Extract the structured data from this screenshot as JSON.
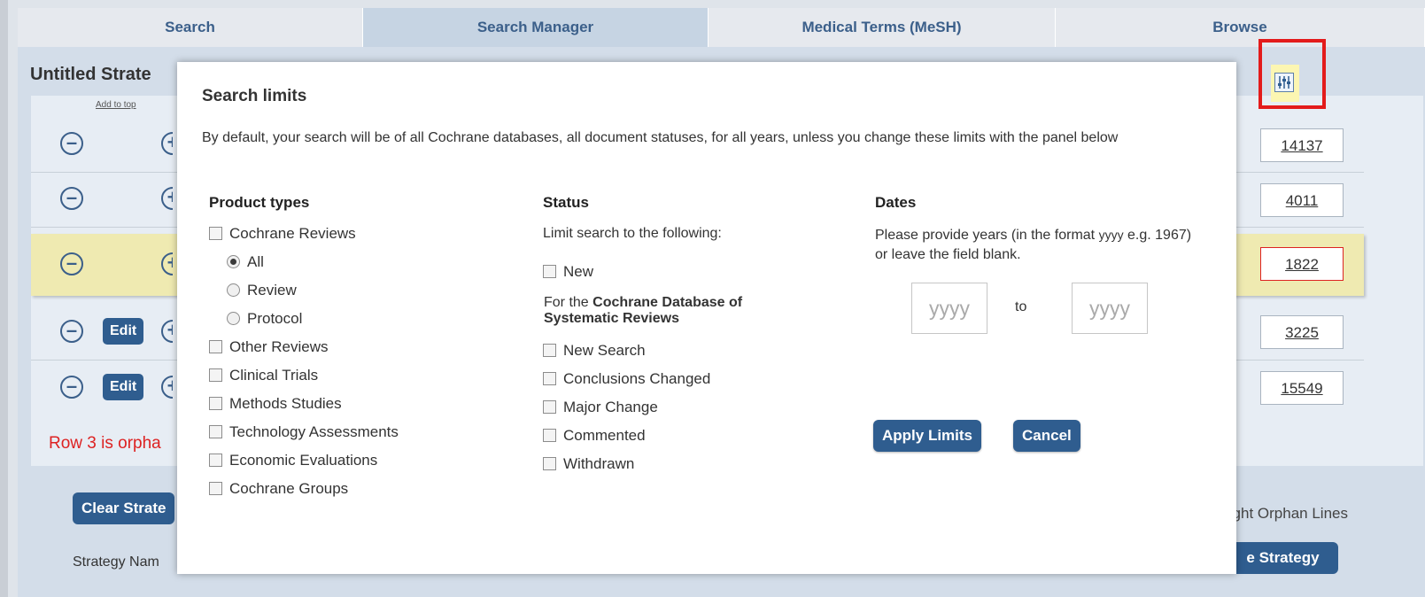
{
  "tabs": [
    {
      "label": "Search"
    },
    {
      "label": "Search Manager",
      "active": true
    },
    {
      "label": "Medical Terms (MeSH)"
    },
    {
      "label": "Browse"
    }
  ],
  "strategy": {
    "title": "Untitled Strate",
    "add_to_top": "Add to top",
    "rows": [
      {
        "count": "14137",
        "has_edit": false
      },
      {
        "count": "4011",
        "has_edit": false
      },
      {
        "count": "1822",
        "has_edit": false,
        "highlighted": true
      },
      {
        "count": "3225",
        "has_edit": true
      },
      {
        "count": "15549",
        "has_edit": true
      }
    ],
    "edit_label": "Edit",
    "orphan_message": "Row 3 is orpha",
    "clear_button": "Clear Strate",
    "strategy_name_label": "Strategy Nam",
    "highlight_orphan_label": "light Orphan Lines",
    "save_button": "e Strategy"
  },
  "modal": {
    "title": "Search limits",
    "description": "By default, your search will be of all Cochrane databases, all document statuses, for all years, unless you change these limits with the panel below",
    "product_types": {
      "heading": "Product types",
      "cochrane_reviews": "Cochrane Reviews",
      "radio_all": "All",
      "radio_review": "Review",
      "radio_protocol": "Protocol",
      "other_reviews": "Other Reviews",
      "clinical_trials": "Clinical Trials",
      "methods_studies": "Methods Studies",
      "technology_assessments": "Technology Assessments",
      "economic_evaluations": "Economic Evaluations",
      "cochrane_groups": "Cochrane Groups"
    },
    "status": {
      "heading": "Status",
      "limit_text": "Limit search to the following:",
      "new": "New",
      "cdsr_prefix": "For the ",
      "cdsr_bold": "Cochrane Database of Systematic Reviews",
      "new_search": "New Search",
      "conclusions_changed": "Conclusions Changed",
      "major_change": "Major Change",
      "commented": "Commented",
      "withdrawn": "Withdrawn"
    },
    "dates": {
      "heading": "Dates",
      "hint_prefix": "Please provide years (in the format ",
      "hint_format": "yyyy",
      "hint_suffix": " e.g. 1967) or leave the field blank.",
      "from_placeholder": "yyyy",
      "to_label": "to",
      "to_placeholder": "yyyy"
    },
    "apply_button": "Apply Limits",
    "cancel_button": "Cancel"
  },
  "colors": {
    "accent": "#2f5d8f",
    "highlight_box": "#e31b1b",
    "orphan_text": "#dd2222",
    "row_highlight": "#efeab1"
  },
  "icons": {
    "remove_row": "minus-circle-icon",
    "add_row": "plus-circle-icon",
    "limits": "sliders-icon"
  }
}
